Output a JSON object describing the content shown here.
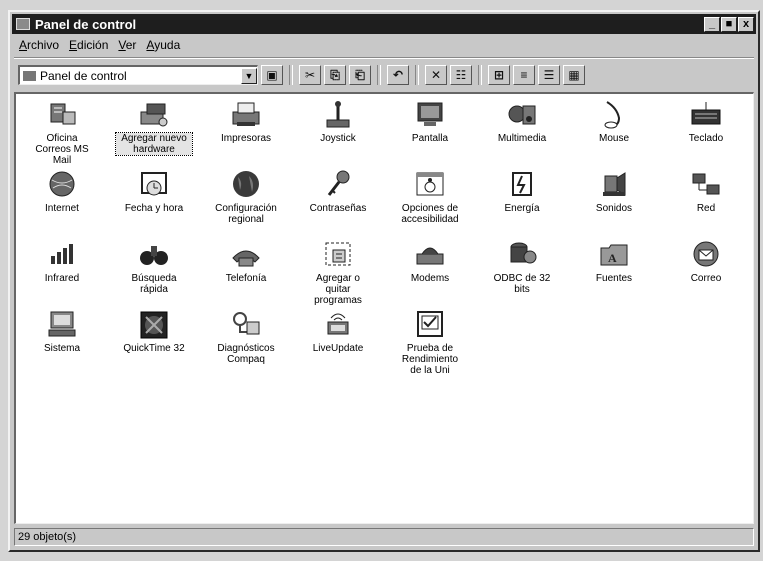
{
  "window": {
    "title": "Panel de control",
    "buttons": [
      "_",
      "■",
      "x"
    ]
  },
  "menu": [
    {
      "label": "Archivo"
    },
    {
      "label": "Edición"
    },
    {
      "label": "Ver"
    },
    {
      "label": "Ayuda"
    }
  ],
  "toolbar": {
    "address": "Panel de control",
    "dropdown_glyph": "▼",
    "buttons": [
      "▣",
      "✂",
      "⎘",
      "⎗",
      "↶",
      "✕",
      "☷",
      "⊞",
      "≡",
      "☰",
      "▦"
    ]
  },
  "items": [
    {
      "label": "Oficina\nCorreos MS\nMail",
      "icon": "mail-office-icon"
    },
    {
      "label": "Agregar nuevo\nhardware",
      "icon": "add-hardware-icon",
      "selected": true
    },
    {
      "label": "Impresoras",
      "icon": "printer-icon"
    },
    {
      "label": "Joystick",
      "icon": "joystick-icon"
    },
    {
      "label": "Pantalla",
      "icon": "display-icon"
    },
    {
      "label": "Multimedia",
      "icon": "multimedia-icon"
    },
    {
      "label": "Mouse",
      "icon": "mouse-icon"
    },
    {
      "label": "Teclado",
      "icon": "keyboard-icon"
    },
    {
      "label": "Internet",
      "icon": "internet-icon"
    },
    {
      "label": "Fecha y hora",
      "icon": "calendar-clock-icon"
    },
    {
      "label": "Configuración\nregional",
      "icon": "globe-icon"
    },
    {
      "label": "Contraseñas",
      "icon": "keys-icon"
    },
    {
      "label": "Opciones de\naccesibilidad",
      "icon": "accessibility-icon"
    },
    {
      "label": "Energía",
      "icon": "power-icon"
    },
    {
      "label": "Sonidos",
      "icon": "speaker-icon"
    },
    {
      "label": "Red",
      "icon": "network-icon"
    },
    {
      "label": "Infrared",
      "icon": "infrared-icon"
    },
    {
      "label": "Búsqueda\nrápida",
      "icon": "binoculars-icon"
    },
    {
      "label": "Telefonía",
      "icon": "telephone-icon"
    },
    {
      "label": "Agregar o\nquitar\nprogramas",
      "icon": "add-remove-programs-icon"
    },
    {
      "label": "Modems",
      "icon": "modem-icon"
    },
    {
      "label": "ODBC de 32\nbits",
      "icon": "odbc-icon"
    },
    {
      "label": "Fuentes",
      "icon": "fonts-folder-icon"
    },
    {
      "label": "Correo",
      "icon": "mail-icon"
    },
    {
      "label": "Sistema",
      "icon": "computer-icon"
    },
    {
      "label": "QuickTime 32",
      "icon": "quicktime-icon"
    },
    {
      "label": "Diagnósticos\nCompaq",
      "icon": "diagnostics-icon"
    },
    {
      "label": "LiveUpdate",
      "icon": "liveupdate-icon"
    },
    {
      "label": "Prueba de\nRendimiento\nde la Uni",
      "icon": "checkbox-icon"
    }
  ],
  "status": {
    "text": "29 objeto(s)"
  }
}
